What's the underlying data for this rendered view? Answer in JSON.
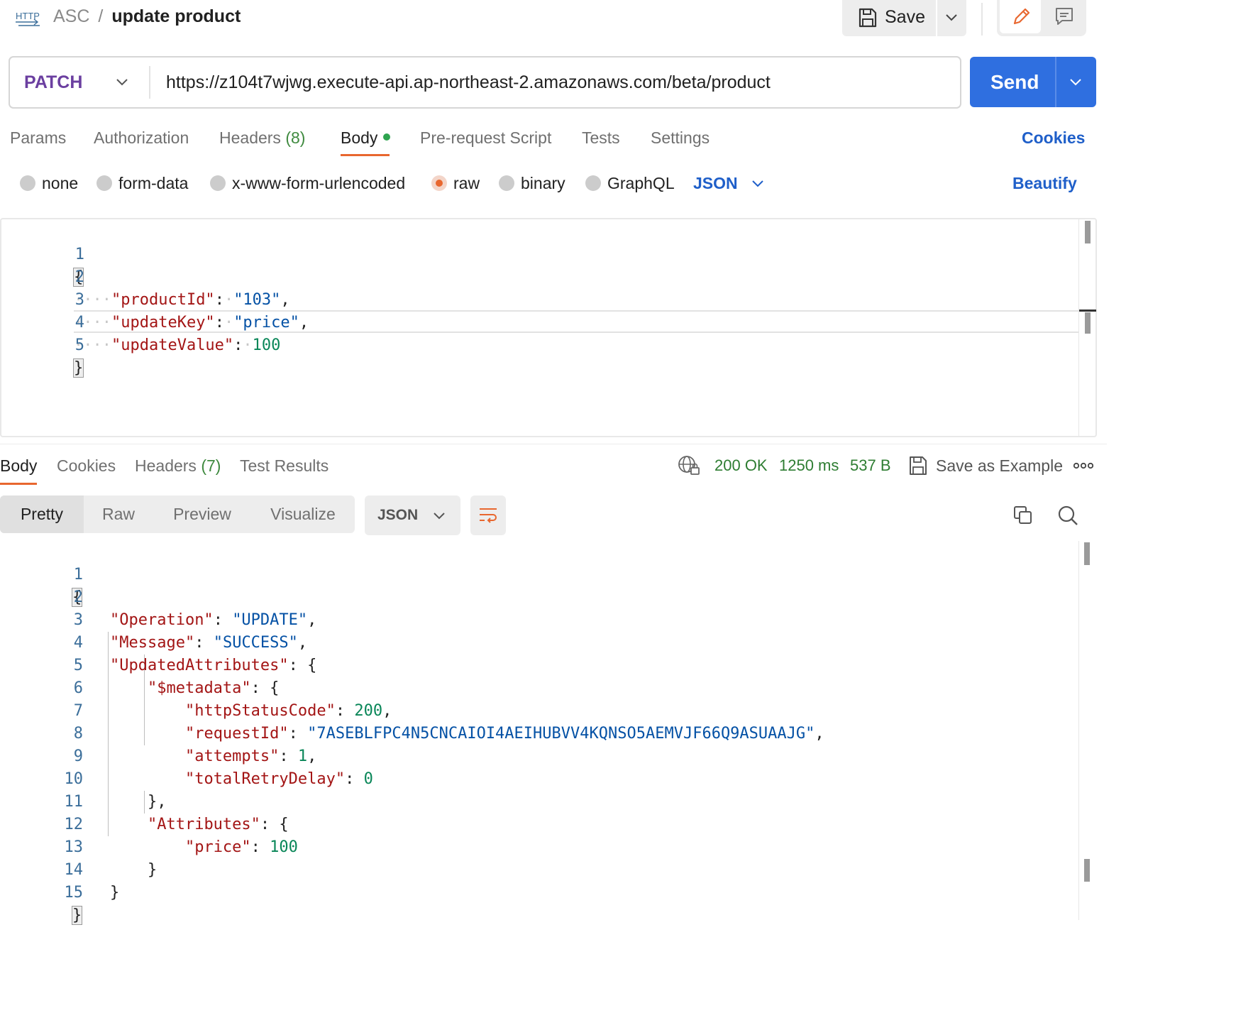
{
  "header": {
    "icon": "http-icon",
    "icon_text": "HTTP",
    "breadcrumb_parent": "ASC",
    "breadcrumb_sep": "/",
    "title": "update product",
    "save_label": "Save"
  },
  "request": {
    "method": "PATCH",
    "url": "https://z104t7wjwg.execute-api.ap-northeast-2.amazonaws.com/beta/product",
    "send_label": "Send"
  },
  "request_tabs": [
    {
      "label": "Params",
      "count": ""
    },
    {
      "label": "Authorization",
      "count": ""
    },
    {
      "label": "Headers",
      "count": "(8)"
    },
    {
      "label": "Body",
      "count": "",
      "active": true
    },
    {
      "label": "Pre-request Script",
      "count": ""
    },
    {
      "label": "Tests",
      "count": ""
    },
    {
      "label": "Settings",
      "count": ""
    }
  ],
  "cookies_link": "Cookies",
  "body_types": [
    "none",
    "form-data",
    "x-www-form-urlencoded",
    "raw",
    "binary",
    "GraphQL"
  ],
  "body_type_selected": "raw",
  "body_language": "JSON",
  "beautify_label": "Beautify",
  "request_body": {
    "line_numbers": [
      "1",
      "2",
      "3",
      "4",
      "5"
    ],
    "open_brace": "{",
    "close_brace": "}",
    "fields": [
      {
        "key": "\"productId\"",
        "value": "\"103\"",
        "trail": ","
      },
      {
        "key": "\"updateKey\"",
        "value": "\"price\"",
        "trail": ","
      },
      {
        "key": "\"updateValue\"",
        "value": "100",
        "trail": ""
      }
    ]
  },
  "response_tabs": [
    {
      "label": "Body",
      "count": "",
      "active": true
    },
    {
      "label": "Cookies",
      "count": ""
    },
    {
      "label": "Headers",
      "count": "(7)"
    },
    {
      "label": "Test Results",
      "count": ""
    }
  ],
  "response_status": {
    "status": "200 OK",
    "time": "1250 ms",
    "size": "537 B"
  },
  "save_as_example": "Save as Example",
  "view_modes": [
    "Pretty",
    "Raw",
    "Preview",
    "Visualize"
  ],
  "view_mode_selected": "Pretty",
  "response_format": "JSON",
  "response_body": {
    "line_numbers": [
      "1",
      "2",
      "3",
      "4",
      "5",
      "6",
      "7",
      "8",
      "9",
      "10",
      "11",
      "12",
      "13",
      "14",
      "15"
    ],
    "brace_open": "{",
    "brace_close": "}",
    "operation_key": "\"Operation\"",
    "operation_value": "\"UPDATE\"",
    "message_key": "\"Message\"",
    "message_value": "\"SUCCESS\"",
    "updated_key": "\"UpdatedAttributes\"",
    "metadata_key": "\"$metadata\"",
    "http_status_key": "\"httpStatusCode\"",
    "http_status_value": "200",
    "request_id_key": "\"requestId\"",
    "request_id_value": "\"7ASEBLFPC4N5CNCAIOI4AEIHUBVV4KQNSO5AEMVJF66Q9ASUAAJG\"",
    "attempts_key": "\"attempts\"",
    "attempts_value": "1",
    "retry_delay_key": "\"totalRetryDelay\"",
    "retry_delay_value": "0",
    "close_comma": "},",
    "attributes_key": "\"Attributes\"",
    "price_key": "\"price\"",
    "price_value": "100",
    "colon": ":",
    "comma": ","
  },
  "colors": {
    "accent": "#e8672f",
    "send_blue": "#2f6fe0",
    "method_purple": "#6b3fa0",
    "status_green": "#2e7d32"
  }
}
